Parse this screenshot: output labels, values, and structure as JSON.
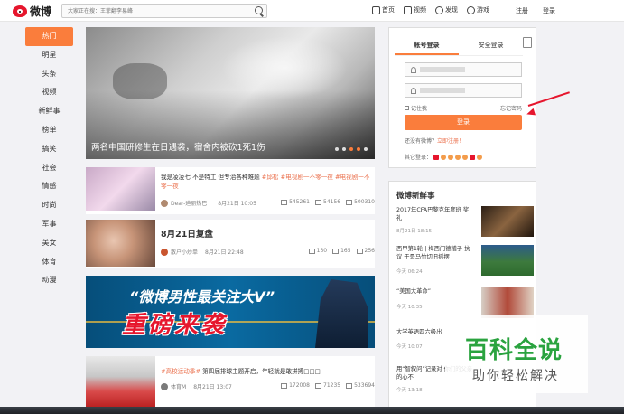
{
  "app": {
    "logo_text": "微博"
  },
  "search": {
    "placeholder": "大家正在搜：王菲翻李易峰"
  },
  "topnav": {
    "items": [
      {
        "label": "首页",
        "icon": "home-icon"
      },
      {
        "label": "视频",
        "icon": "video-icon"
      },
      {
        "label": "发现",
        "icon": "discover-icon"
      },
      {
        "label": "游戏",
        "icon": "game-icon"
      }
    ],
    "register": "注册",
    "login": "登录"
  },
  "leftmenu": {
    "items": [
      "热门",
      "明星",
      "头条",
      "视频",
      "新鲜事",
      "榜单",
      "搞笑",
      "社会",
      "情感",
      "时尚",
      "军事",
      "美女",
      "体育",
      "动漫"
    ],
    "active_index": 0
  },
  "hero": {
    "caption": "两名中国研修生在日遇袭，宿舍内被砍1死1伤"
  },
  "feed": [
    {
      "title_prefix": "我是凌凌七 不是特工 但专治各种难题 ",
      "tags": "#邱松 #电视剧一不零一夜 #电视剧一不零一夜",
      "author": "Dear-迪丽热巴",
      "time": "8月21日 10:05",
      "reposts": "545261",
      "comments": "54156",
      "likes": "500310"
    },
    {
      "title": "8月21日复盘",
      "author": "散户小炒单",
      "time": "8月21日 22:48",
      "reposts": "130",
      "comments": "165",
      "likes": "256"
    },
    {
      "banner_line1": "“微博男性最关注大V”",
      "banner_line2": "重磅来袭"
    },
    {
      "tag": "#高校运动季#",
      "title": " 第四届排球主题开启，年轻就是敢拼搏□□□",
      "author": "体育M",
      "time": "8月21日 13:07",
      "reposts": "172008",
      "comments": "71235",
      "likes": "533694"
    }
  ],
  "login_box": {
    "tab_account": "帐号登录",
    "tab_secure": "安全登录",
    "remember": "记住我",
    "forgot": "忘记密码",
    "button": "登录",
    "no_account": "还没有微博？",
    "register_now": "立即注册！",
    "other_login": "其它登录："
  },
  "news": {
    "header": "微博新鲜事",
    "items": [
      {
        "title": "2017年CFA巴黎克年度班 奖礼",
        "time": "8月21日 18:15"
      },
      {
        "title": "西甲第1轮 | 梅西门德稽子 抗议 于是马竹切旧摇摆",
        "time": "今天 06:24"
      },
      {
        "title": "“美国大革命”",
        "time": "今天 10:35"
      },
      {
        "title": "大学英语四六级出",
        "time": "今天 10:07"
      },
      {
        "title": "用“智叙问”记录对 你们的父亲的心不",
        "time": "今天 13:18"
      }
    ]
  },
  "watermark": {
    "line1": "百科全说",
    "line2": "助你轻松解决"
  },
  "colors": {
    "accent": "#fa7d3c",
    "brand_red": "#e6162d",
    "watermark_green": "#2aa33f"
  }
}
